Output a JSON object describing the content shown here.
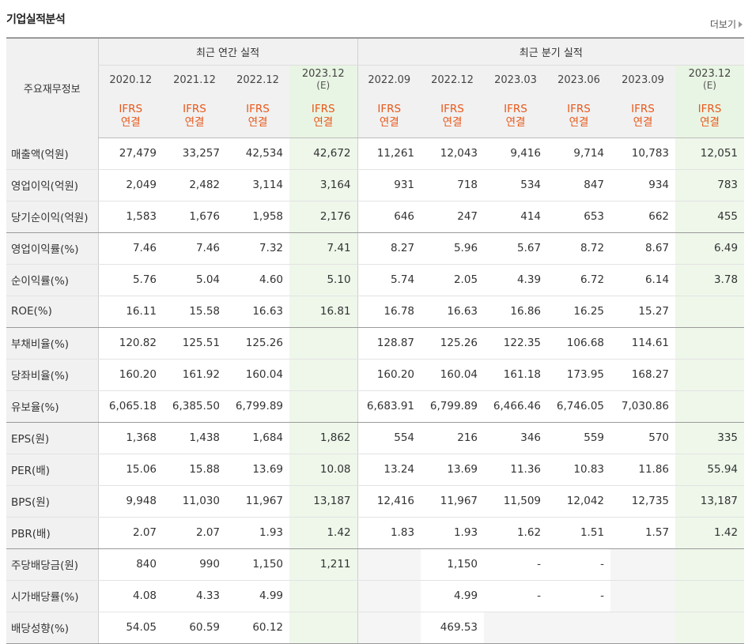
{
  "header": {
    "title": "기업실적분석",
    "more_label": "더보기"
  },
  "table": {
    "row_header_label": "주요재무정보",
    "annual_group_label": "최근 연간 실적",
    "quarterly_group_label": "최근 분기 실적",
    "periods": [
      {
        "label": "2020.12",
        "estimate": false,
        "basis_top": "IFRS",
        "basis_bottom": "연결"
      },
      {
        "label": "2021.12",
        "estimate": false,
        "basis_top": "IFRS",
        "basis_bottom": "연결"
      },
      {
        "label": "2022.12",
        "estimate": false,
        "basis_top": "IFRS",
        "basis_bottom": "연결"
      },
      {
        "label": "2023.12",
        "estimate": true,
        "estimate_mark": "(E)",
        "basis_top": "IFRS",
        "basis_bottom": "연결"
      },
      {
        "label": "2022.09",
        "estimate": false,
        "basis_top": "IFRS",
        "basis_bottom": "연결"
      },
      {
        "label": "2022.12",
        "estimate": false,
        "basis_top": "IFRS",
        "basis_bottom": "연결"
      },
      {
        "label": "2023.03",
        "estimate": false,
        "basis_top": "IFRS",
        "basis_bottom": "연결"
      },
      {
        "label": "2023.06",
        "estimate": false,
        "basis_top": "IFRS",
        "basis_bottom": "연결"
      },
      {
        "label": "2023.09",
        "estimate": false,
        "basis_top": "IFRS",
        "basis_bottom": "연결"
      },
      {
        "label": "2023.12",
        "estimate": true,
        "estimate_mark": "(E)",
        "basis_top": "IFRS",
        "basis_bottom": "연결"
      }
    ],
    "rows": [
      {
        "label": "매출액(억원)",
        "values": [
          "27,479",
          "33,257",
          "42,534",
          "42,672",
          "11,261",
          "12,043",
          "9,416",
          "9,714",
          "10,783",
          "12,051"
        ]
      },
      {
        "label": "영업이익(억원)",
        "values": [
          "2,049",
          "2,482",
          "3,114",
          "3,164",
          "931",
          "718",
          "534",
          "847",
          "934",
          "783"
        ]
      },
      {
        "label": "당기순이익(억원)",
        "values": [
          "1,583",
          "1,676",
          "1,958",
          "2,176",
          "646",
          "247",
          "414",
          "653",
          "662",
          "455"
        ]
      },
      {
        "label": "영업이익률(%)",
        "values": [
          "7.46",
          "7.46",
          "7.32",
          "7.41",
          "8.27",
          "5.96",
          "5.67",
          "8.72",
          "8.67",
          "6.49"
        ]
      },
      {
        "label": "순이익률(%)",
        "values": [
          "5.76",
          "5.04",
          "4.60",
          "5.10",
          "5.74",
          "2.05",
          "4.39",
          "6.72",
          "6.14",
          "3.78"
        ]
      },
      {
        "label": "ROE(%)",
        "values": [
          "16.11",
          "15.58",
          "16.63",
          "16.81",
          "16.78",
          "16.63",
          "16.86",
          "16.25",
          "15.27",
          ""
        ]
      },
      {
        "label": "부채비율(%)",
        "values": [
          "120.82",
          "125.51",
          "125.26",
          "",
          "128.87",
          "125.26",
          "122.35",
          "106.68",
          "114.61",
          ""
        ]
      },
      {
        "label": "당좌비율(%)",
        "values": [
          "160.20",
          "161.92",
          "160.04",
          "",
          "160.20",
          "160.04",
          "161.18",
          "173.95",
          "168.27",
          ""
        ]
      },
      {
        "label": "유보율(%)",
        "values": [
          "6,065.18",
          "6,385.50",
          "6,799.89",
          "",
          "6,683.91",
          "6,799.89",
          "6,466.46",
          "6,746.05",
          "7,030.86",
          ""
        ]
      },
      {
        "label": "EPS(원)",
        "values": [
          "1,368",
          "1,438",
          "1,684",
          "1,862",
          "554",
          "216",
          "346",
          "559",
          "570",
          "335"
        ]
      },
      {
        "label": "PER(배)",
        "values": [
          "15.06",
          "15.88",
          "13.69",
          "10.08",
          "13.24",
          "13.69",
          "11.36",
          "10.83",
          "11.86",
          "55.94"
        ]
      },
      {
        "label": "BPS(원)",
        "values": [
          "9,948",
          "11,030",
          "11,967",
          "13,187",
          "12,416",
          "11,967",
          "11,509",
          "12,042",
          "12,735",
          "13,187"
        ]
      },
      {
        "label": "PBR(배)",
        "values": [
          "2.07",
          "2.07",
          "1.93",
          "1.42",
          "1.83",
          "1.93",
          "1.62",
          "1.51",
          "1.57",
          "1.42"
        ]
      },
      {
        "label": "주당배당금(원)",
        "values": [
          "840",
          "990",
          "1,150",
          "1,211",
          "",
          "1,150",
          "-",
          "-",
          "",
          ""
        ]
      },
      {
        "label": "시가배당률(%)",
        "values": [
          "4.08",
          "4.33",
          "4.99",
          "",
          "",
          "4.99",
          "-",
          "-",
          "",
          ""
        ]
      },
      {
        "label": "배당성향(%)",
        "values": [
          "54.05",
          "60.59",
          "60.12",
          "",
          "",
          "469.53",
          "",
          "",
          "",
          ""
        ]
      }
    ]
  }
}
